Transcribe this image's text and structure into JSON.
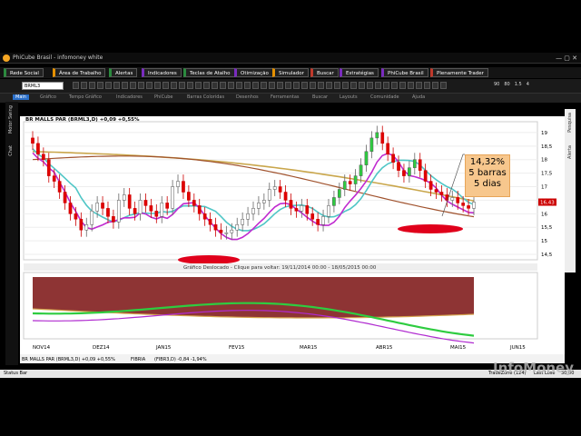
{
  "window": {
    "title": "PhiCube Brasil - infomoney white"
  },
  "menu": [
    {
      "label": "Rede Social",
      "color": "#2b8a3e"
    },
    {
      "label": "Área de Trabalho",
      "color": "#e69100"
    },
    {
      "label": "Alertas",
      "color": "#2b8a3e"
    },
    {
      "label": "Indicadores",
      "color": "#7a2bbf"
    },
    {
      "label": "Teclas de Atalho",
      "color": "#2b8a3e"
    },
    {
      "label": "Otimização",
      "color": "#7a2bbf"
    },
    {
      "label": "Simulador",
      "color": "#e69100"
    },
    {
      "label": "Buscar",
      "color": "#c0392b"
    },
    {
      "label": "Estratégias",
      "color": "#7a2bbf"
    },
    {
      "label": "PhiCube Brasil",
      "color": "#7a2bbf"
    },
    {
      "label": "Plenamente Trader",
      "color": "#c0392b"
    }
  ],
  "toolbar": {
    "symbol": "BRML3",
    "zoom": [
      "90",
      "80",
      "1.5",
      "4"
    ]
  },
  "tabs": [
    "Main",
    "Gráfico",
    "Tempo Gráfico",
    "Indicadores",
    "PhiCube",
    "Barras Coloridas",
    "Desenhos",
    "Ferramentas",
    "Buscar",
    "Layouts",
    "Comunidade",
    "Ajuda"
  ],
  "sidebar": {
    "labels": [
      "Motor Swing",
      "Chat"
    ]
  },
  "rightbar": {
    "labels": [
      "Alerta",
      "Pesquisa"
    ]
  },
  "chart": {
    "header": "BR MALLS PAR (BRML3,D) +0,09 +0,55%",
    "lower_title": "Gráfico Deslocado - Clique para voltar: 19/11/2014 00:00 - 18/05/2015 00:00",
    "footer_symbols": [
      "BR MALLS PAR (BRML3,D) +0,09 +0,55%",
      "FIBRIA",
      "(FIBR3,D) -0,84 -1,94%"
    ],
    "callout": [
      "14,32%",
      "5 barras",
      "5 dias"
    ],
    "last_price": "16,43"
  },
  "chart_data": {
    "type": "candlestick",
    "x_ticks": [
      "NOV14",
      "DEZ14",
      "JAN15",
      "FEV15",
      "MAR15",
      "ABR15",
      "MAI15",
      "JUN15"
    ],
    "y_ticks": [
      14.5,
      15,
      15.5,
      16,
      16.5,
      17,
      17.5,
      18,
      18.5,
      19
    ],
    "ylim": [
      14.3,
      19.4
    ],
    "close": [
      18.6,
      18.2,
      18.0,
      17.4,
      17.2,
      16.8,
      16.4,
      16.0,
      15.8,
      15.4,
      15.6,
      16.1,
      16.4,
      16.2,
      15.9,
      15.7,
      16.5,
      16.7,
      16.2,
      16.0,
      16.5,
      16.3,
      16.1,
      15.9,
      16.4,
      16.2,
      17.0,
      17.2,
      16.8,
      16.5,
      16.3,
      16.0,
      15.8,
      15.6,
      15.4,
      15.3,
      15.3,
      15.4,
      15.6,
      15.8,
      16.0,
      16.2,
      16.4,
      16.5,
      16.9,
      17.0,
      16.8,
      16.5,
      16.2,
      16.1,
      16.3,
      16.0,
      15.8,
      15.6,
      15.9,
      16.3,
      16.6,
      16.9,
      17.2,
      17.1,
      17.4,
      17.8,
      18.3,
      18.8,
      19.0,
      18.6,
      18.2,
      17.9,
      17.6,
      17.4,
      17.7,
      18.0,
      17.6,
      17.2,
      16.9,
      16.8,
      16.7,
      16.5,
      16.6,
      16.4,
      16.3,
      16.2,
      16.43
    ],
    "ma_gold_start": 18.3,
    "ma_gold_end": 16.5,
    "lower": {
      "type": "oscillator",
      "shaded": true
    }
  },
  "status": {
    "label": "Status Bar",
    "right": [
      "TradeZone (124)",
      "Last Lose",
      "30:00"
    ]
  },
  "watermark": "InfoMoney"
}
